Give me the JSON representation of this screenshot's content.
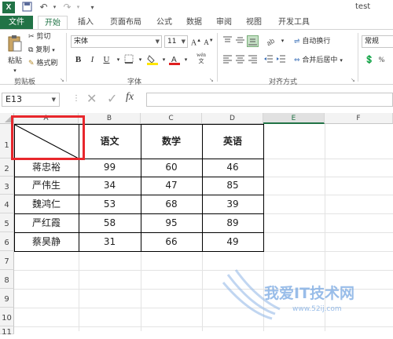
{
  "titlebar": {
    "app_icon": "X",
    "title": "test"
  },
  "tabs": [
    "文件",
    "开始",
    "插入",
    "页面布局",
    "公式",
    "数据",
    "审阅",
    "视图",
    "开发工具"
  ],
  "ribbon": {
    "clipboard": {
      "paste": "粘贴",
      "cut": "剪切",
      "copy": "复制",
      "format_painter": "格式刷",
      "group": "剪贴板"
    },
    "font": {
      "name": "宋体",
      "size": "11",
      "group": "字体",
      "wen": "wén"
    },
    "alignment": {
      "wrap": "自动换行",
      "merge": "合并后居中",
      "group": "对齐方式"
    },
    "number": {
      "format": "常规"
    }
  },
  "formula_bar": {
    "cell_ref": "E13",
    "fx": "fx",
    "value": ""
  },
  "grid": {
    "columns": [
      "A",
      "B",
      "C",
      "D",
      "E",
      "F"
    ],
    "rows": [
      "1",
      "2",
      "3",
      "4",
      "5",
      "6",
      "7",
      "8",
      "9",
      "10",
      "11"
    ],
    "headers": [
      "语文",
      "数学",
      "英语"
    ],
    "students": [
      {
        "name": "蒋忠裕",
        "scores": [
          "99",
          "60",
          "46"
        ]
      },
      {
        "name": "严伟生",
        "scores": [
          "34",
          "47",
          "85"
        ]
      },
      {
        "name": "魏鸿仁",
        "scores": [
          "53",
          "68",
          "39"
        ]
      },
      {
        "name": "严红霞",
        "scores": [
          "58",
          "95",
          "89"
        ]
      },
      {
        "name": "蔡昊静",
        "scores": [
          "31",
          "66",
          "49"
        ]
      }
    ]
  },
  "watermark": {
    "main": "我爱IT技术网",
    "sub": "www.52ij.com"
  },
  "colors": {
    "accent": "#217346",
    "highlight": "#e8272c"
  }
}
